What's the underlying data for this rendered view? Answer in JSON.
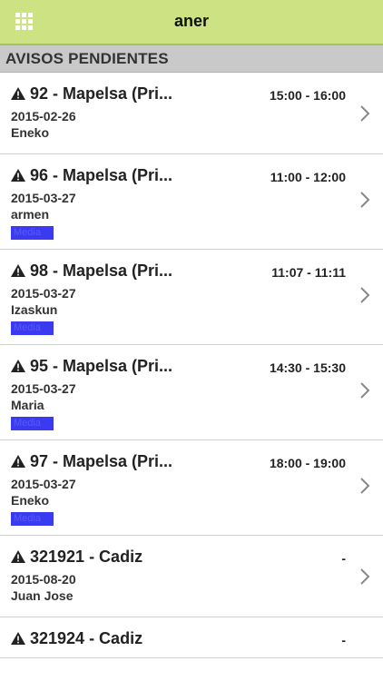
{
  "app": {
    "title": "aner"
  },
  "section": {
    "title": "AVISOS PENDIENTES"
  },
  "items": [
    {
      "title": "92 - Mapelsa (Pri...",
      "time": "15:00 - 16:00",
      "date": "2015-02-26",
      "person": "Eneko",
      "priority": ""
    },
    {
      "title": "96 - Mapelsa (Pri...",
      "time": "11:00 - 12:00",
      "date": "2015-03-27",
      "person": "armen",
      "priority": "Media"
    },
    {
      "title": "98 - Mapelsa (Pri...",
      "time": "11:07 - 11:11",
      "date": "2015-03-27",
      "person": "Izaskun",
      "priority": "Media"
    },
    {
      "title": "95 - Mapelsa (Pri...",
      "time": "14:30 - 15:30",
      "date": "2015-03-27",
      "person": "Maria",
      "priority": "Media"
    },
    {
      "title": "97 - Mapelsa (Pri...",
      "time": "18:00 - 19:00",
      "date": "2015-03-27",
      "person": "Eneko",
      "priority": "Media"
    },
    {
      "title": "321921 - Cadiz",
      "time": "-",
      "date": "2015-08-20",
      "person": "Juan Jose",
      "priority": ""
    },
    {
      "title": "321924 - Cadiz",
      "time": "-",
      "date": "",
      "person": "",
      "priority": ""
    }
  ],
  "colors": {
    "header": "#cde283",
    "section": "#c9c9c9",
    "badge": "#3a3af0"
  },
  "icons": {
    "menu": "grid-icon",
    "warning": "warning-icon",
    "chevron": "chevron-right-icon"
  }
}
